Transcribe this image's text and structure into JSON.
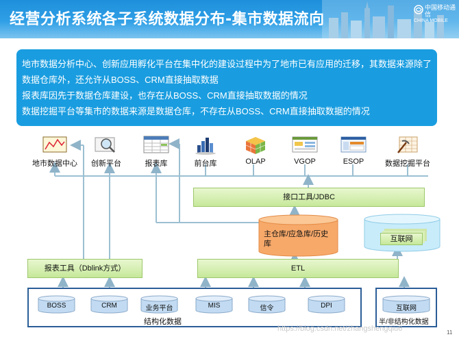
{
  "title": "经营分析系统各子系统数据分布-集市数据流向",
  "brand": {
    "cn": "中国移动通信",
    "en": "CHINA MOBILE"
  },
  "info_lines": [
    "地市数据分析中心、创新应用孵化平台在集中化的建设过程中为了地市已有应用的迁移，其数据来源除了",
    "数据仓库外，还允许从BOSS、CRM直接抽取数据",
    "报表库因先于数据仓库建设，也存在从BOSS、CRM直接抽取数据的情况",
    "数据挖掘平台等集市的数据来源是数据仓库，不存在从BOSS、CRM直接抽取数据的情况"
  ],
  "apps": [
    {
      "label": "地市数据中心",
      "icon": "chart-board-icon"
    },
    {
      "label": "创新平台",
      "icon": "magnifier-icon"
    },
    {
      "label": "报表库",
      "icon": "report-grid-icon"
    },
    {
      "label": "前台库",
      "icon": "bar-chart-icon"
    },
    {
      "label": "OLAP",
      "icon": "cube-icon"
    },
    {
      "label": "VGOP",
      "icon": "dashboard-icon"
    },
    {
      "label": "ESOP",
      "icon": "window-icon"
    },
    {
      "label": "数据挖掘平台",
      "icon": "mining-icon"
    }
  ],
  "interface_bar": "接口工具/JDBC",
  "warehouse": "主仓库/应急库/历史库",
  "internet_stack": "互联网",
  "report_tool": "报表工具（Dblink方式）",
  "etl": "ETL",
  "structured_sources": [
    "BOSS",
    "CRM",
    "业务平台",
    "MIS",
    "信令",
    "DPI"
  ],
  "structured_label": "结构化数据",
  "unstructured_sources": [
    "互联网"
  ],
  "unstructured_label": "半/非结构化数据",
  "watermark": "https://blog.csdn.net/zhangshengqiu6",
  "page_number": "11",
  "colors": {
    "header": "#1e8fdb",
    "info_box": "#1a9de0",
    "bar_fill": "#c6e89a",
    "cylinder": "#f7a96a",
    "group_border": "#2a5d97"
  }
}
